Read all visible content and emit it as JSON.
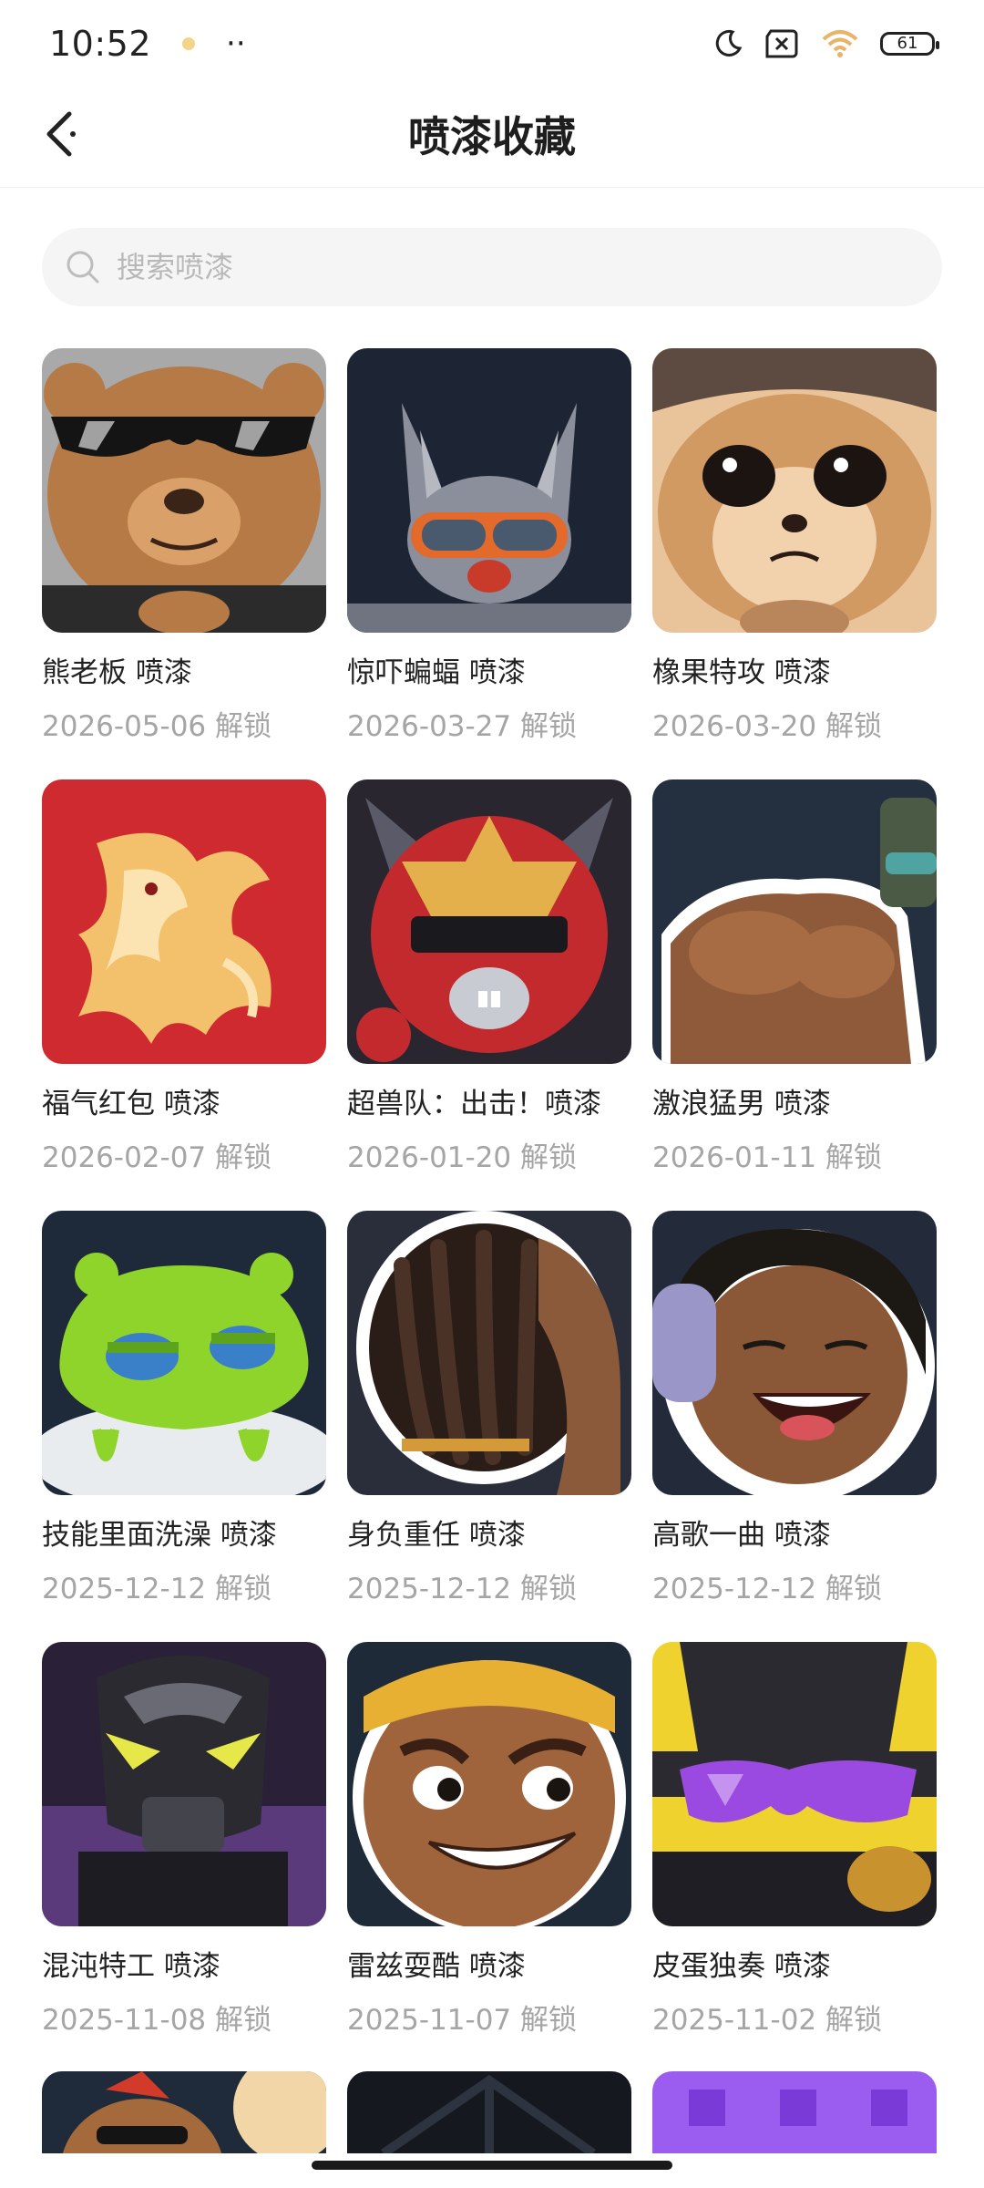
{
  "status_bar": {
    "time": "10:52",
    "dots": "··",
    "battery": "61"
  },
  "header": {
    "title": "喷漆收藏"
  },
  "search": {
    "placeholder": "搜索喷漆"
  },
  "items": [
    {
      "title": "熊老板 喷漆",
      "date": "2026-05-06",
      "unlock": "解锁",
      "art": "bear"
    },
    {
      "title": "惊吓蝙蝠 喷漆",
      "date": "2026-03-27",
      "unlock": "解锁",
      "art": "bat"
    },
    {
      "title": "橡果特攻 喷漆",
      "date": "2026-03-20",
      "unlock": "解锁",
      "art": "squirrel"
    },
    {
      "title": "福气红包 喷漆",
      "date": "2026-02-07",
      "unlock": "解锁",
      "art": "horse"
    },
    {
      "title": "超兽队：出击！喷漆",
      "date": "2026-01-20",
      "unlock": "解锁",
      "art": "hero"
    },
    {
      "title": "激浪猛男 喷漆",
      "date": "2026-01-11",
      "unlock": "解锁",
      "art": "muscle"
    },
    {
      "title": "技能里面洗澡 喷漆",
      "date": "2025-12-12",
      "unlock": "解锁",
      "art": "slime"
    },
    {
      "title": "身负重任 喷漆",
      "date": "2025-12-12",
      "unlock": "解锁",
      "art": "dreads"
    },
    {
      "title": "高歌一曲 喷漆",
      "date": "2025-12-12",
      "unlock": "解锁",
      "art": "singer"
    },
    {
      "title": "混沌特工 喷漆",
      "date": "2025-11-08",
      "unlock": "解锁",
      "art": "robot"
    },
    {
      "title": "雷兹耍酷 喷漆",
      "date": "2025-11-07",
      "unlock": "解锁",
      "art": "boy"
    },
    {
      "title": "皮蛋独奏 喷漆",
      "date": "2025-11-02",
      "unlock": "解锁",
      "art": "sunglasses"
    }
  ],
  "colors": {
    "text": "#222222",
    "subtext": "#a5a5a5",
    "search_bg": "#f5f5f5"
  },
  "icons": [
    "back-arrow-icon",
    "search-icon",
    "moon-icon",
    "sim-off-icon",
    "wifi-icon",
    "battery-icon"
  ]
}
